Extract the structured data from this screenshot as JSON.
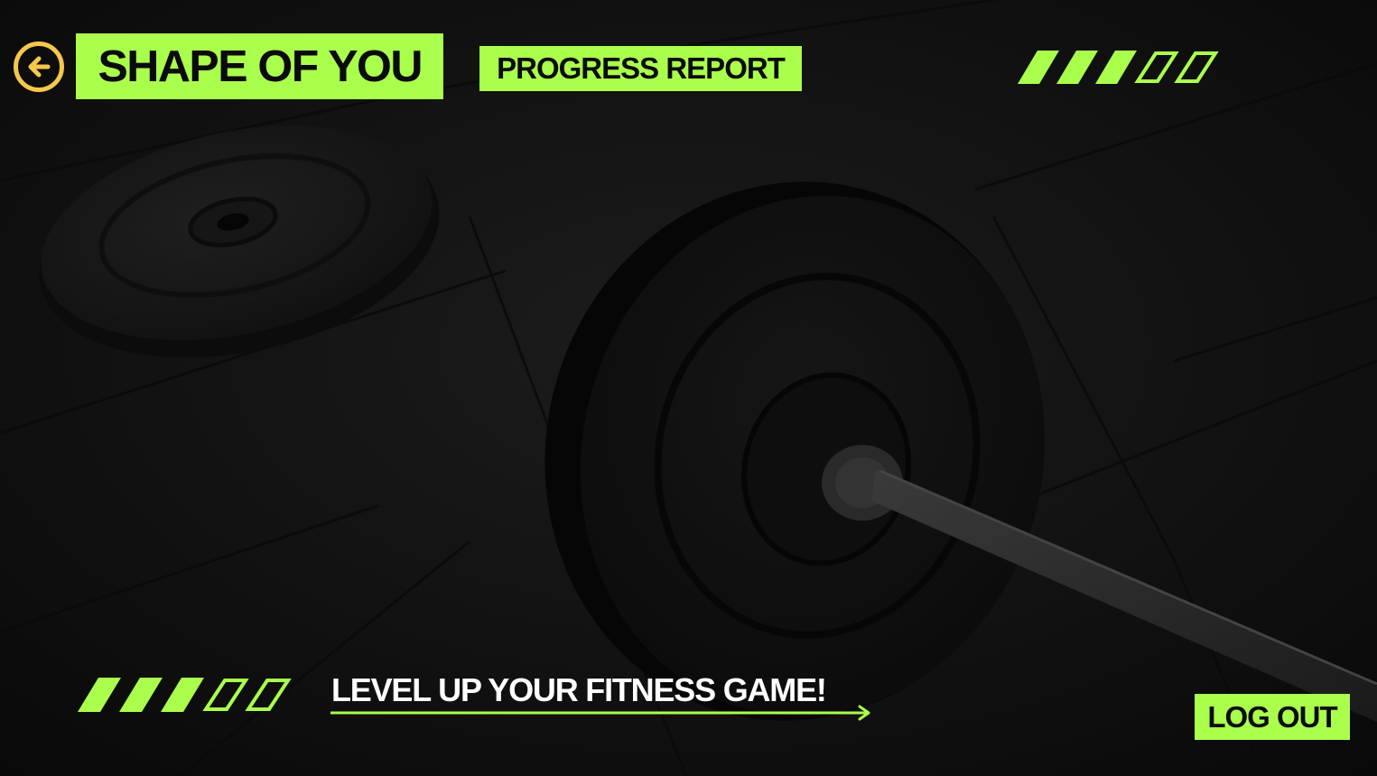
{
  "header": {
    "back_icon": "arrow-left-circle-icon",
    "app_title": "SHAPE OF YOU",
    "page_title": "PROGRESS REPORT",
    "stripe_icon": "progress-stripes-icon"
  },
  "footer": {
    "tagline": "LEVEL UP YOUR FITNESS GAME!",
    "tagline_icon": "arrow-right-icon",
    "logout_label": "LOG OUT"
  },
  "background": {
    "image": "barbell-weight-plates-on-gym-floor"
  },
  "colors": {
    "accent": "#aaff4d",
    "back_ring": "#f4c84a",
    "text_dark": "#0b0b0b",
    "text_light": "#ffffff",
    "background": "#0d0d0d"
  }
}
